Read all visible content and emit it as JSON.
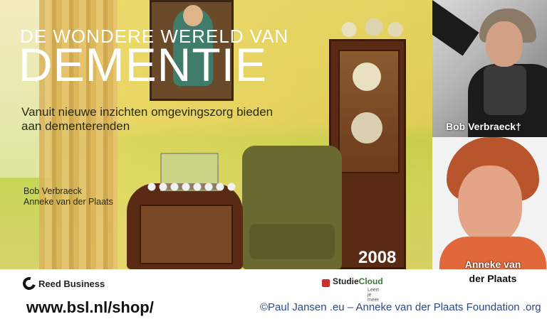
{
  "cover": {
    "title_small": "DE WONDERE WERELD VAN",
    "title_big": "DEMENTIE",
    "subtitle": "Vanuit nieuwe inzichten omgevingszorg bieden aan dementerenden",
    "author_1": "Bob Verbraeck",
    "author_2": "Anneke van der Plaats",
    "year": "2008",
    "publisher": "Reed Business",
    "studie_1": "Studie",
    "studie_2": "Cloud",
    "studie_tag": "Leert je meer"
  },
  "photos": {
    "bob_caption": "Bob Verbraeck†",
    "anneke_caption_1": "Anneke van",
    "anneke_caption_2": "der Plaats"
  },
  "footer": {
    "url": "www.bsl.nl/shop/",
    "credit": "©Paul Jansen .eu – Anneke van der Plaats Foundation .org"
  },
  "colors": {
    "cover_yellow": "#e2cf5a",
    "cover_green": "#bfd04a",
    "credit_blue": "#2b4a8a"
  }
}
